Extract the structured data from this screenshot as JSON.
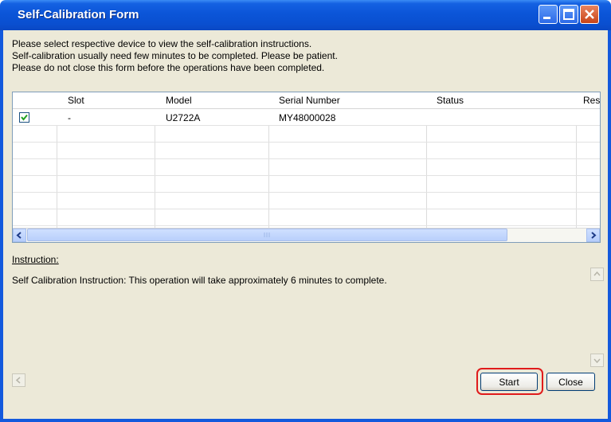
{
  "window": {
    "title": "Self-Calibration Form"
  },
  "messages": [
    "Please select respective device to view the self-calibration instructions.",
    "Self-calibration usually need few minutes to be completed. Please be patient.",
    "Please do not close this form before the operations have been completed."
  ],
  "table": {
    "headers": [
      "",
      "Slot",
      "Model",
      "Serial Number",
      "Status",
      "Resu"
    ],
    "rows": [
      {
        "checked": true,
        "slot": "-",
        "model": "U2722A",
        "serial": "MY48000028",
        "status": "",
        "result": ""
      }
    ]
  },
  "instruction": {
    "label": "Instruction:",
    "text": "Self Calibration Instruction: This operation will take approximately 6 minutes to complete."
  },
  "buttons": {
    "start": "Start",
    "close": "Close"
  },
  "colors": {
    "titlebar": "#0b55d8",
    "client": "#ece9d8",
    "highlight": "#e01b1b"
  }
}
